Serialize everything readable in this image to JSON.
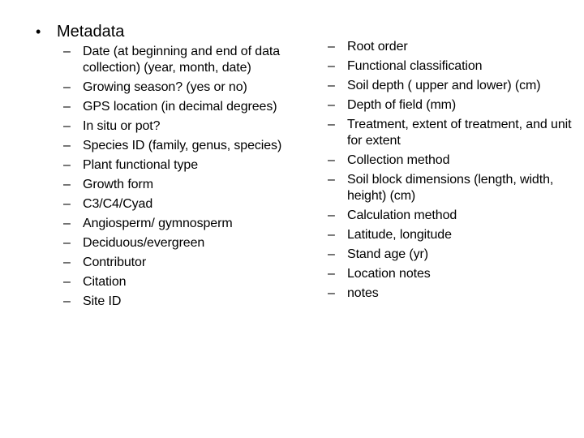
{
  "slide": {
    "main_bullet": {
      "symbol": "•",
      "label": "Metadata"
    },
    "dash_symbol": "–",
    "left_items": [
      "Date (at beginning and end of data collection) (year, month, date)",
      "Growing season? (yes or no)",
      "GPS location (in decimal degrees)",
      "In situ or pot?",
      "Species ID (family, genus, species)",
      "Plant functional type",
      "Growth form",
      "C3/C4/Cyad",
      "Angiosperm/ gymnosperm",
      "Deciduous/evergreen",
      "Contributor",
      "Citation",
      "Site ID"
    ],
    "right_items": [
      "Root order",
      "Functional classification",
      "Soil depth ( upper and lower) (cm)",
      "Depth of field (mm)",
      "Treatment, extent of treatment, and unit for extent",
      "Collection method",
      "Soil block dimensions (length, width, height) (cm)",
      "Calculation method",
      "Latitude, longitude",
      "Stand age (yr)",
      "Location notes",
      "notes"
    ]
  }
}
